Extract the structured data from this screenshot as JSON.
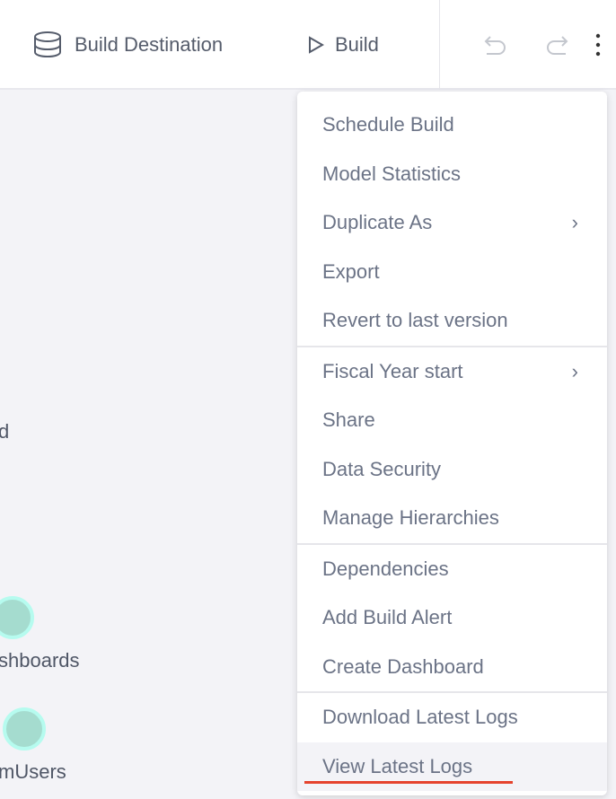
{
  "header": {
    "build_destination_label": "Build Destination",
    "build_label": "Build",
    "icons": [
      "database-icon",
      "play-icon",
      "undo-icon",
      "redo-icon",
      "more-vertical-icon"
    ]
  },
  "canvas": {
    "labels": [
      "d",
      "shboards",
      "mUsers"
    ]
  },
  "menu": {
    "sections": [
      [
        {
          "label": "Schedule Build"
        },
        {
          "label": "Model Statistics"
        },
        {
          "label": "Duplicate As",
          "submenu": true
        },
        {
          "label": "Export"
        },
        {
          "label": "Revert to last version"
        }
      ],
      [
        {
          "label": "Fiscal Year start",
          "submenu": true
        },
        {
          "label": "Share"
        },
        {
          "label": "Data Security"
        },
        {
          "label": "Manage Hierarchies"
        }
      ],
      [
        {
          "label": "Dependencies"
        },
        {
          "label": "Add Build Alert"
        },
        {
          "label": "Create Dashboard"
        }
      ],
      [
        {
          "label": "Download Latest Logs"
        },
        {
          "label": "View Latest Logs",
          "highlighted": true
        }
      ]
    ],
    "highlight_color": "#e5432d"
  }
}
